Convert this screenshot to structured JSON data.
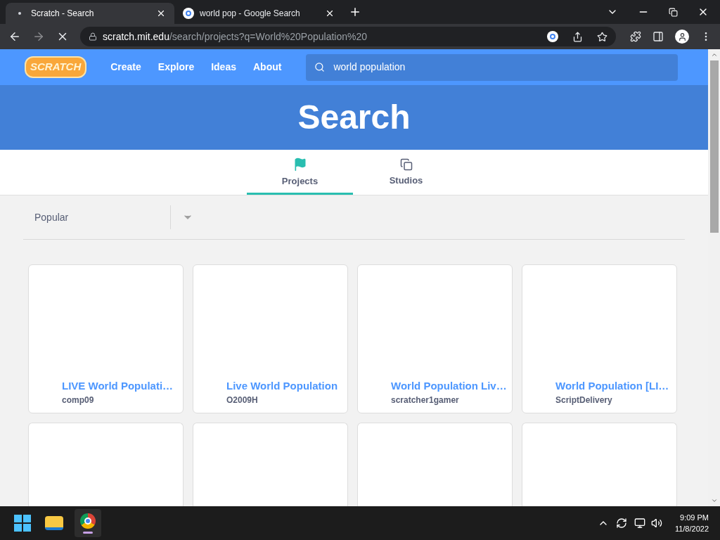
{
  "browser": {
    "tabs": [
      {
        "title": "Scratch - Search",
        "selected": true
      },
      {
        "title": "world pop - Google Search",
        "selected": false
      }
    ],
    "url_host": "scratch.mit.edu",
    "url_path": "/search/projects?q=World%20Population%20",
    "loading": true
  },
  "nav": {
    "logo": "SCRATCH",
    "links": [
      "Create",
      "Explore",
      "Ideas",
      "About"
    ],
    "search_value": "world population"
  },
  "banner": {
    "title": "Search"
  },
  "tabs": [
    {
      "label": "Projects",
      "selected": true
    },
    {
      "label": "Studios",
      "selected": false
    }
  ],
  "sort": {
    "value": "Popular"
  },
  "projects": [
    {
      "title": "LIVE World Populati…",
      "author": "comp09"
    },
    {
      "title": "Live World Population",
      "author": "O2009H"
    },
    {
      "title": "World Population Liv…",
      "author": "scratcher1gamer"
    },
    {
      "title": "World Population [LI…",
      "author": "ScriptDelivery"
    }
  ],
  "taskbar": {
    "time": "9:09 PM",
    "date": "11/8/2022"
  }
}
